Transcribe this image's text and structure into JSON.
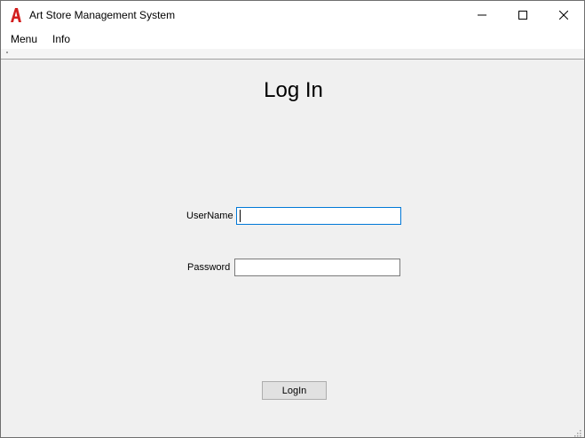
{
  "window": {
    "title": "Art Store Management System",
    "controls": [
      "minimize-icon",
      "maximize-icon",
      "close-icon"
    ]
  },
  "menubar": {
    "items": [
      {
        "label": "Menu"
      },
      {
        "label": "Info"
      }
    ]
  },
  "form": {
    "heading": "Log In",
    "username_label": "UserName",
    "username_value": "",
    "password_label": "Password",
    "password_value": "",
    "submit_label": "LogIn"
  },
  "colors": {
    "app_icon": "#d21f1f",
    "focus_border": "#0078d7",
    "client_bg": "#f0f0f0"
  }
}
